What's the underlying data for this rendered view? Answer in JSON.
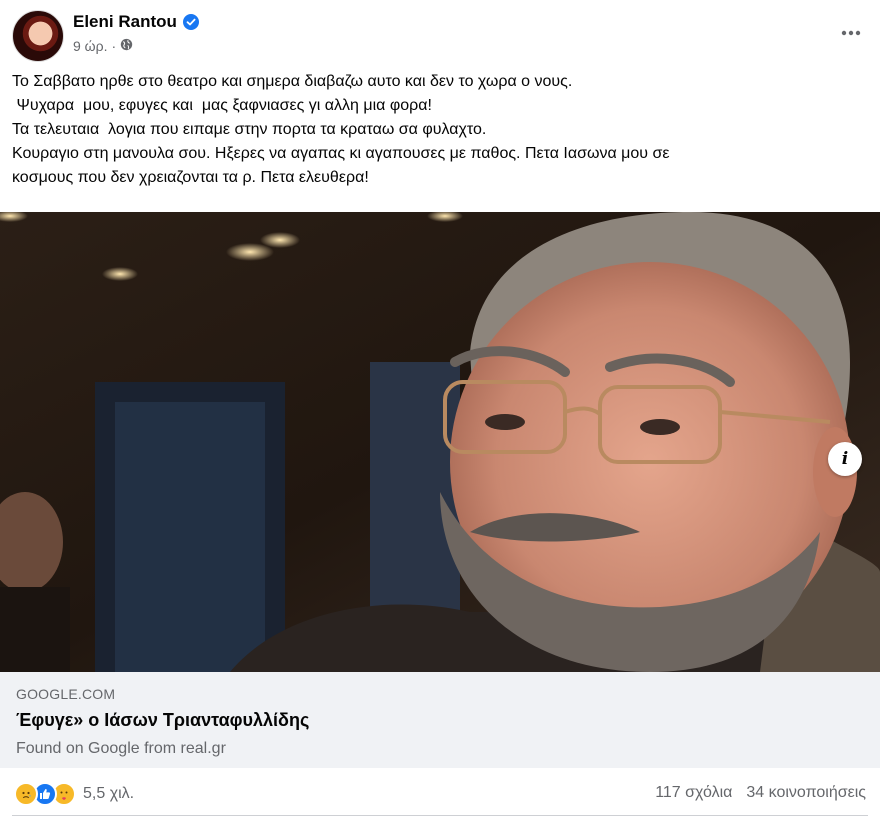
{
  "author": {
    "name": "Eleni Rantou",
    "time": "9 ώρ.",
    "separator": "·"
  },
  "post": {
    "lines": [
      "Το Σαββατο ηρθε στο θεατρο και σημερα διαβαζω αυτο και δεν το χωρα ο νους.",
      " Ψυχαρα  μου, εφυγες και  μας ξαφνιασες γι αλλη μια φορα!",
      "Τα τελευταια  λογια που ειπαμε στην πορτα τα κραταω σα φυλαχτο.",
      "Κουραγιο στη μανουλα σου. Ηξερες να αγαπας κι αγαπουσες με παθος. Πετα Ιασωνα μου σε",
      "κοσμους που δεν χρειαζονται τα ρ. Πετα ελευθερα!"
    ]
  },
  "link": {
    "domain": "GOOGLE.COM",
    "title": "Έφυγε» ο Ιάσων Τριανταφυλλίδης",
    "subtitle": "Found on Google from real.gr",
    "info_label": "i"
  },
  "footer": {
    "reaction_count": "5,5 χιλ.",
    "comments": "117 σχόλια",
    "shares": "34 κοινοποιήσεις"
  },
  "icons": {
    "verified": "verified-badge-icon",
    "privacy": "globe-icon",
    "more": "more-options-icon",
    "reactions": [
      "sad-reaction-icon",
      "like-reaction-icon",
      "care-reaction-icon"
    ]
  },
  "colors": {
    "brand_blue": "#1877f2",
    "secondary_text": "#65676b",
    "link_bg": "#f0f2f5",
    "reaction_yellow": "#f7b928"
  }
}
